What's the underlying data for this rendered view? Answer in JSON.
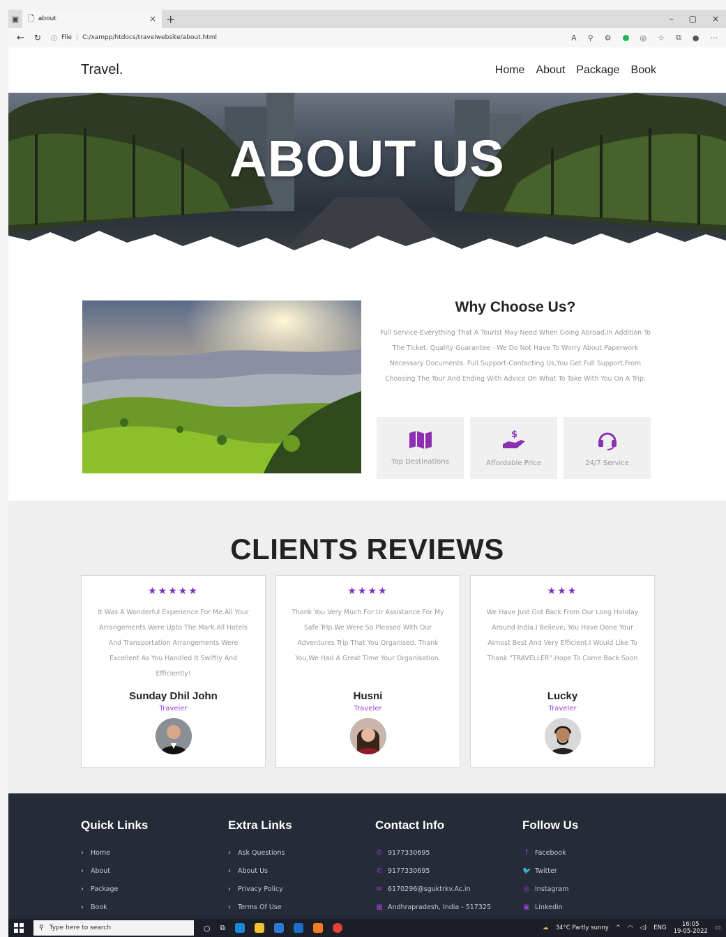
{
  "browser": {
    "tab_title": "about",
    "url_prefix": "File",
    "url": "C:/xampp/htdocs/travelwebsite/about.html"
  },
  "header": {
    "logo": "Travel.",
    "nav": [
      "Home",
      "About",
      "Package",
      "Book"
    ]
  },
  "hero": {
    "title": "ABOUT US"
  },
  "why": {
    "title": "Why Choose Us?",
    "text": "Full Service-Everything That A Tourist May Need When Going Abroad,In Addition To The Ticket. Quality Guarantee - We Do Not Have To Worry About Paperwork Necessary Documents. Full Support-Contacting Us,You Get Full Support,From Choosing The Tour And Ending With Advice On What To Take With You On A Trip.",
    "features": [
      {
        "icon": "map-icon",
        "label": "Top Destinations"
      },
      {
        "icon": "hand-coin-icon",
        "label": "Affordable Price"
      },
      {
        "icon": "headset-icon",
        "label": "24/7 Service"
      }
    ]
  },
  "reviews": {
    "title": "CLIENTS REVIEWS",
    "items": [
      {
        "stars": "★★★★★",
        "rating": 5,
        "text": "It Was A Wonderful Experience For Me.All Your Arrangements Were Upto The Mark.All Hotels And Transportation Arrangements Were Excellent As You Handled It Swiftly And Efficiently!",
        "name": "Sunday Dhil John",
        "role": "Traveler"
      },
      {
        "stars": "★★★★",
        "rating": 4,
        "text": "Thank You Very Much For Ur Assistance For My Safe Trip.We Were So Pleased With Our Adventures Trip That You Organised. Thank You,We Had A Great Time Your Organisation.",
        "name": "Husni",
        "role": "Traveler"
      },
      {
        "stars": "★★★",
        "rating": 3,
        "text": "We Have Just Got Back From Our Long Holiday Around India.I Believe, You Have Done Your Almost Best And Very Efficient.I Would Like To Thank \"TRAVELLER\".Hope To Come Back Soon",
        "name": "Lucky",
        "role": "Traveler"
      }
    ]
  },
  "footer": {
    "quick": {
      "title": "Quick Links",
      "items": [
        "Home",
        "About",
        "Package",
        "Book"
      ]
    },
    "extra": {
      "title": "Extra Links",
      "items": [
        "Ask Questions",
        "About Us",
        "Privacy Policy",
        "Terms Of Use"
      ]
    },
    "contact": {
      "title": "Contact Info",
      "items": [
        "9177330695",
        "9177330695",
        "6170296@sguktrkv.Ac.in",
        "Andhrapradesh, India - 517325"
      ]
    },
    "follow": {
      "title": "Follow Us",
      "items": [
        "Facebook",
        "Twitter",
        "Instagram",
        "Linkedin"
      ]
    }
  },
  "taskbar": {
    "search_placeholder": "Type here to search",
    "weather": "34°C Partly sunny",
    "lang": "ENG",
    "time": "16:05",
    "date": "19-05-2022"
  }
}
